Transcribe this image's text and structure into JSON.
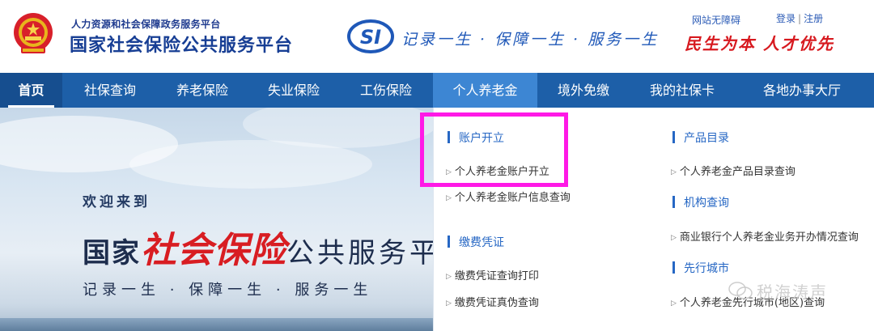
{
  "header": {
    "org_top": "人力资源和社会保障政务服务平台",
    "org_title": "国家社会保险公共服务平台",
    "slogan": "记录一生 · 保障一生 · 服务一生",
    "access_link": "网站无障碍",
    "login": "登录",
    "login_sep": "|",
    "register": "注册",
    "red_slogan": "民生为本 人才优先"
  },
  "nav": {
    "items": [
      {
        "label": "首页"
      },
      {
        "label": "社保查询"
      },
      {
        "label": "养老保险"
      },
      {
        "label": "失业保险"
      },
      {
        "label": "工伤保险"
      },
      {
        "label": "个人养老金"
      },
      {
        "label": "境外免缴"
      },
      {
        "label": "我的社保卡"
      },
      {
        "label": "各地办事大厅"
      }
    ],
    "active_index": 5
  },
  "hero": {
    "welcome": "欢迎来到",
    "title_a": "国家",
    "title_b": "社会保险",
    "title_c": "公共服务平",
    "subtitle": "记录一生 · 保障一生 · 服务一生"
  },
  "dropdown": {
    "left": {
      "account_head": "账户开立",
      "account_links": [
        "个人养老金账户开立",
        "个人养老金账户信息查询"
      ],
      "voucher_head": "缴费凭证",
      "voucher_links": [
        "缴费凭证查询打印",
        "缴费凭证真伪查询"
      ]
    },
    "right": {
      "product_head": "产品目录",
      "product_links": [
        "个人养老金产品目录查询"
      ],
      "org_head": "机构查询",
      "org_links": [
        "商业银行个人养老金业务开办情况查询"
      ],
      "city_head": "先行城市",
      "city_links": [
        "个人养老金先行城市(地区)查询"
      ]
    }
  },
  "watermark": {
    "text": "税海涛声"
  },
  "colors": {
    "nav_bg": "#1d5fa8",
    "nav_active": "#3d86d3",
    "brand_blue": "#173e94",
    "accent_red": "#d7191f",
    "highlight": "#ff19e6"
  }
}
